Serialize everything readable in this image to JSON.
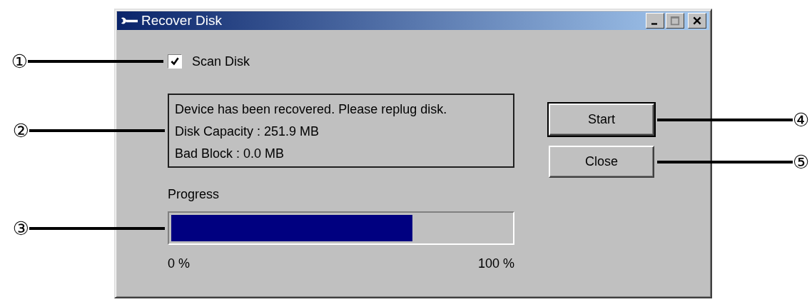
{
  "window": {
    "title": "Recover Disk"
  },
  "scan_disk": {
    "label": "Scan Disk",
    "checked": true
  },
  "status_lines": [
    "Device has been recovered. Please replug disk.",
    "Disk Capacity : 251.9 MB",
    "Bad Block : 0.0 MB"
  ],
  "progress": {
    "label": "Progress",
    "level": 0.71,
    "min_label": "0 %",
    "max_label": "100 %"
  },
  "buttons": [
    {
      "label": "Start",
      "default": true
    },
    {
      "label": "Close",
      "default": false
    }
  ],
  "callouts": [
    {
      "number": "①"
    },
    {
      "number": "②"
    },
    {
      "number": "③"
    },
    {
      "number": "④"
    },
    {
      "number": "⑤"
    }
  ]
}
